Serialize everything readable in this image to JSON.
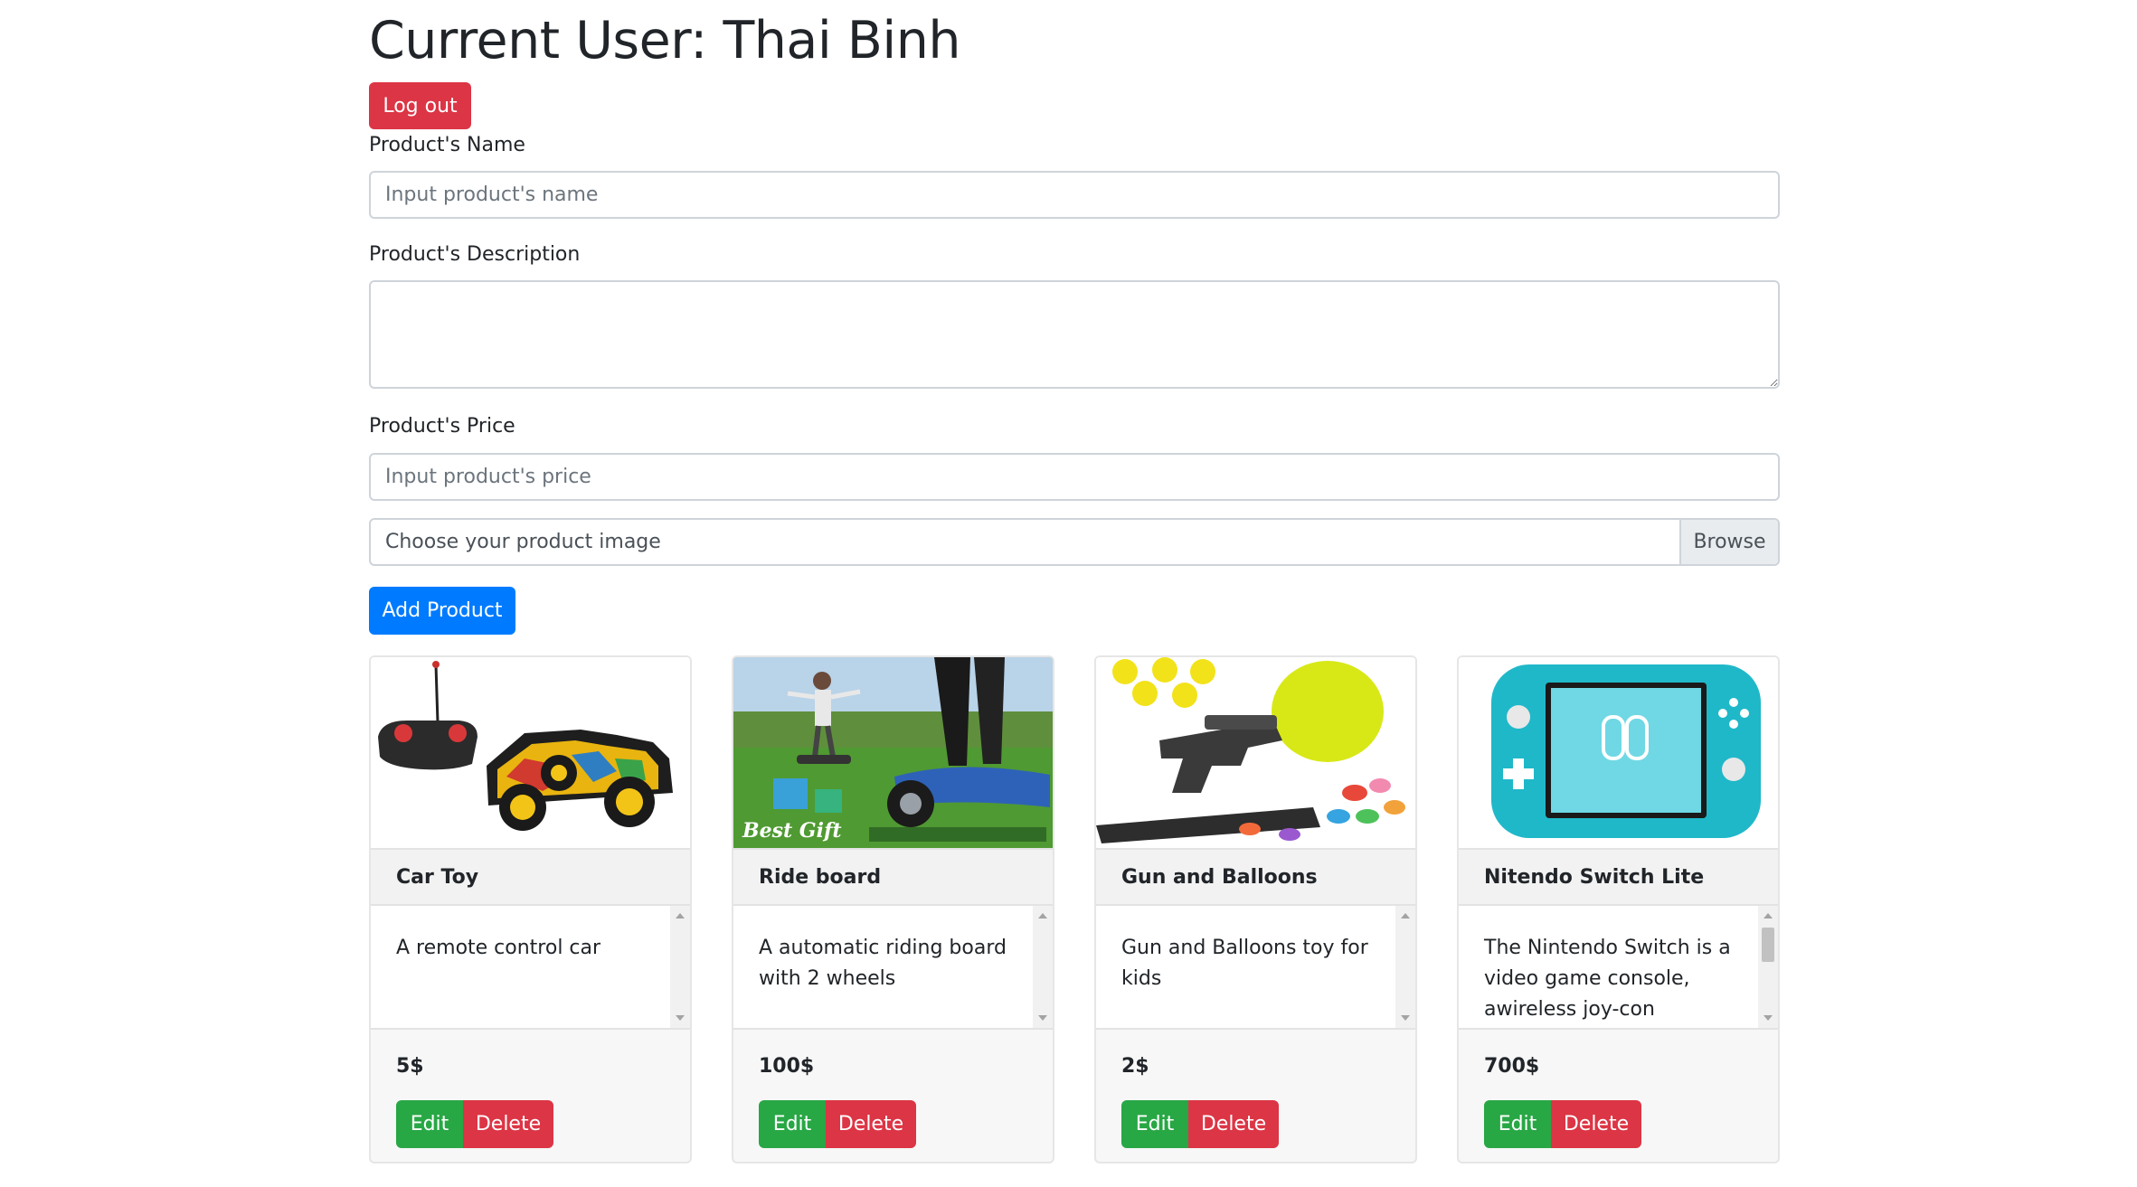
{
  "header": {
    "title": "Current User: Thai Binh",
    "logout_label": "Log out"
  },
  "form": {
    "name_label": "Product's Name",
    "name_placeholder": "Input product's name",
    "name_value": "",
    "description_label": "Product's Description",
    "description_value": "",
    "price_label": "Product's Price",
    "price_placeholder": "Input product's price",
    "price_value": "",
    "image_placeholder": "Choose your product image",
    "browse_label": "Browse",
    "add_label": "Add Product"
  },
  "colors": {
    "primary": "#007bff",
    "danger": "#dc3545",
    "success": "#28a745"
  },
  "products": [
    {
      "name": "Car Toy",
      "description": "A remote control car",
      "price": "5$",
      "image": "car-toy-photo",
      "edit_label": "Edit",
      "delete_label": "Delete"
    },
    {
      "name": "Ride board",
      "description": "A automatic riding board with 2 wheels",
      "price": "100$",
      "image": "ride-board-photo",
      "image_caption": "Best Gift",
      "edit_label": "Edit",
      "delete_label": "Delete"
    },
    {
      "name": "Gun and Balloons",
      "description": "Gun and Balloons toy for kids",
      "price": "2$",
      "image": "gun-balloons-photo",
      "edit_label": "Edit",
      "delete_label": "Delete"
    },
    {
      "name": "Nitendo Switch Lite",
      "description": "The Nintendo Switch is a video game console, awireless joy-con controller",
      "price": "700$",
      "image": "nintendo-switch-photo",
      "edit_label": "Edit",
      "delete_label": "Delete"
    }
  ]
}
